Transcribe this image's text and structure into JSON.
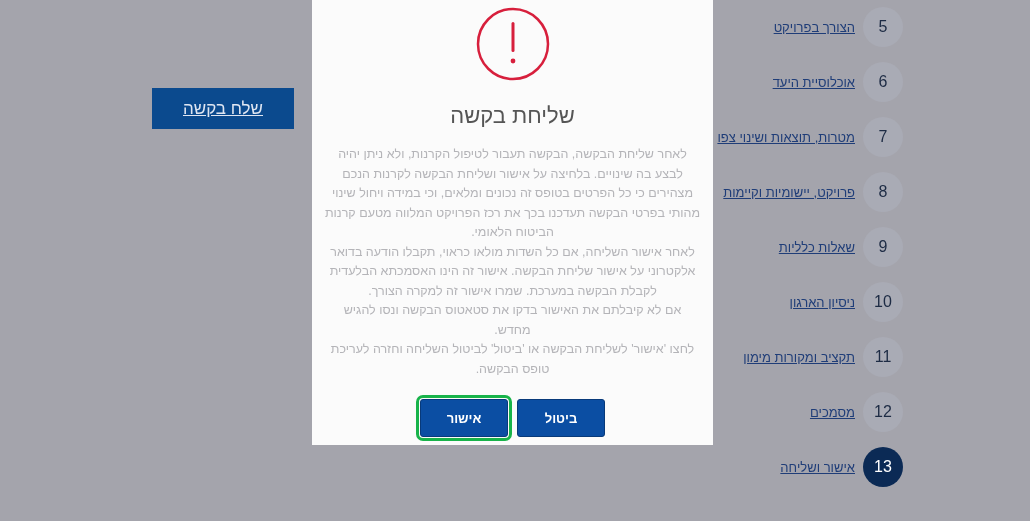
{
  "send_button": {
    "label": "שלח בקשה"
  },
  "steps": [
    {
      "number": "5",
      "label": "הצורך בפרויקט",
      "selected": false
    },
    {
      "number": "6",
      "label": "אוכלוסיית היעד",
      "selected": false
    },
    {
      "number": "7",
      "label": "מטרות, תוצאות ושינוי צפו",
      "selected": false
    },
    {
      "number": "8",
      "label": "פרויקט, יישומיות וקיימות",
      "selected": false
    },
    {
      "number": "9",
      "label": "שאלות כלליות",
      "selected": false
    },
    {
      "number": "10",
      "label": "ניסיון הארגון",
      "selected": false
    },
    {
      "number": "11",
      "label": "תקציב ומקורות מימון",
      "selected": false
    },
    {
      "number": "12",
      "label": "מסמכים",
      "selected": false
    },
    {
      "number": "13",
      "label": "אישור ושליחה",
      "selected": true
    }
  ],
  "dialog": {
    "title": "שליחת בקשה",
    "paragraphs": [
      "לאחר שליחת הבקשה, הבקשה תעבור לטיפול הקרנות, ולא ניתן יהיה לבצע בה שינויים. בלחיצה על אישור ושליחת הבקשה לקרנות הנכם מצהירים כי כל הפרטים בטופס זה נכונים ומלאים, וכי במידה ויחול שינוי מהותי בפרטי הבקשה תעדכנו בכך את רכז הפרויקט המלווה מטעם קרנות הביטוח הלאומי.",
      "לאחר אישור השליחה, אם כל השדות מולאו כראוי, תקבלו הודעה בדואר אלקטרוני על אישור שליחת הבקשה. אישור זה הינו האסמכתא הבלעדית לקבלת הבקשה במערכת. שמרו אישור זה למקרה הצורך.",
      "אם לא קיבלתם את האישור בדקו את סטאטוס הבקשה ונסו להגיש מחדש.",
      "לחצו 'אישור' לשליחת הבקשה או 'ביטול' לביטול השליחה וחזרה לעריכת טופס הבקשה."
    ],
    "buttons": [
      {
        "label": "ביטול",
        "focused": false
      },
      {
        "label": "אישור",
        "focused": true
      }
    ]
  }
}
